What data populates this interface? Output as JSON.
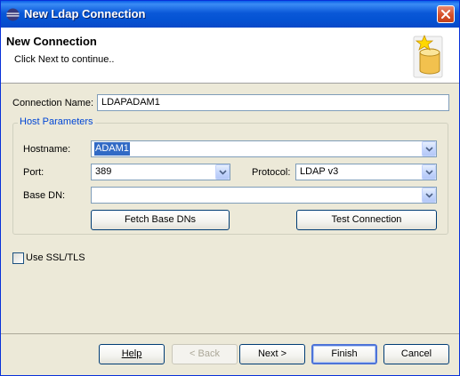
{
  "window": {
    "title": "New Ldap Connection"
  },
  "header": {
    "title": "New Connection",
    "description": "Click Next to continue.."
  },
  "connection": {
    "label": "Connection Name:",
    "value": "LDAPADAM1"
  },
  "host_parameters": {
    "legend": "Host Parameters",
    "hostname": {
      "label": "Hostname:",
      "value": "ADAM1"
    },
    "port": {
      "label": "Port:",
      "value": "389"
    },
    "protocol": {
      "label": "Protocol:",
      "value": "LDAP v3"
    },
    "base_dn": {
      "label": "Base DN:",
      "value": ""
    },
    "fetch_button": "Fetch Base DNs",
    "test_button": "Test Connection"
  },
  "ssl": {
    "label": "Use SSL/TLS",
    "checked": false
  },
  "buttons": {
    "help": "Help",
    "back": "< Back",
    "next": "Next >",
    "finish": "Finish",
    "cancel": "Cancel"
  },
  "colors": {
    "title_bar": "#0453d3",
    "dialog_bg": "#ece9d8",
    "accent_label": "#0046d5",
    "selection": "#316ac5"
  }
}
